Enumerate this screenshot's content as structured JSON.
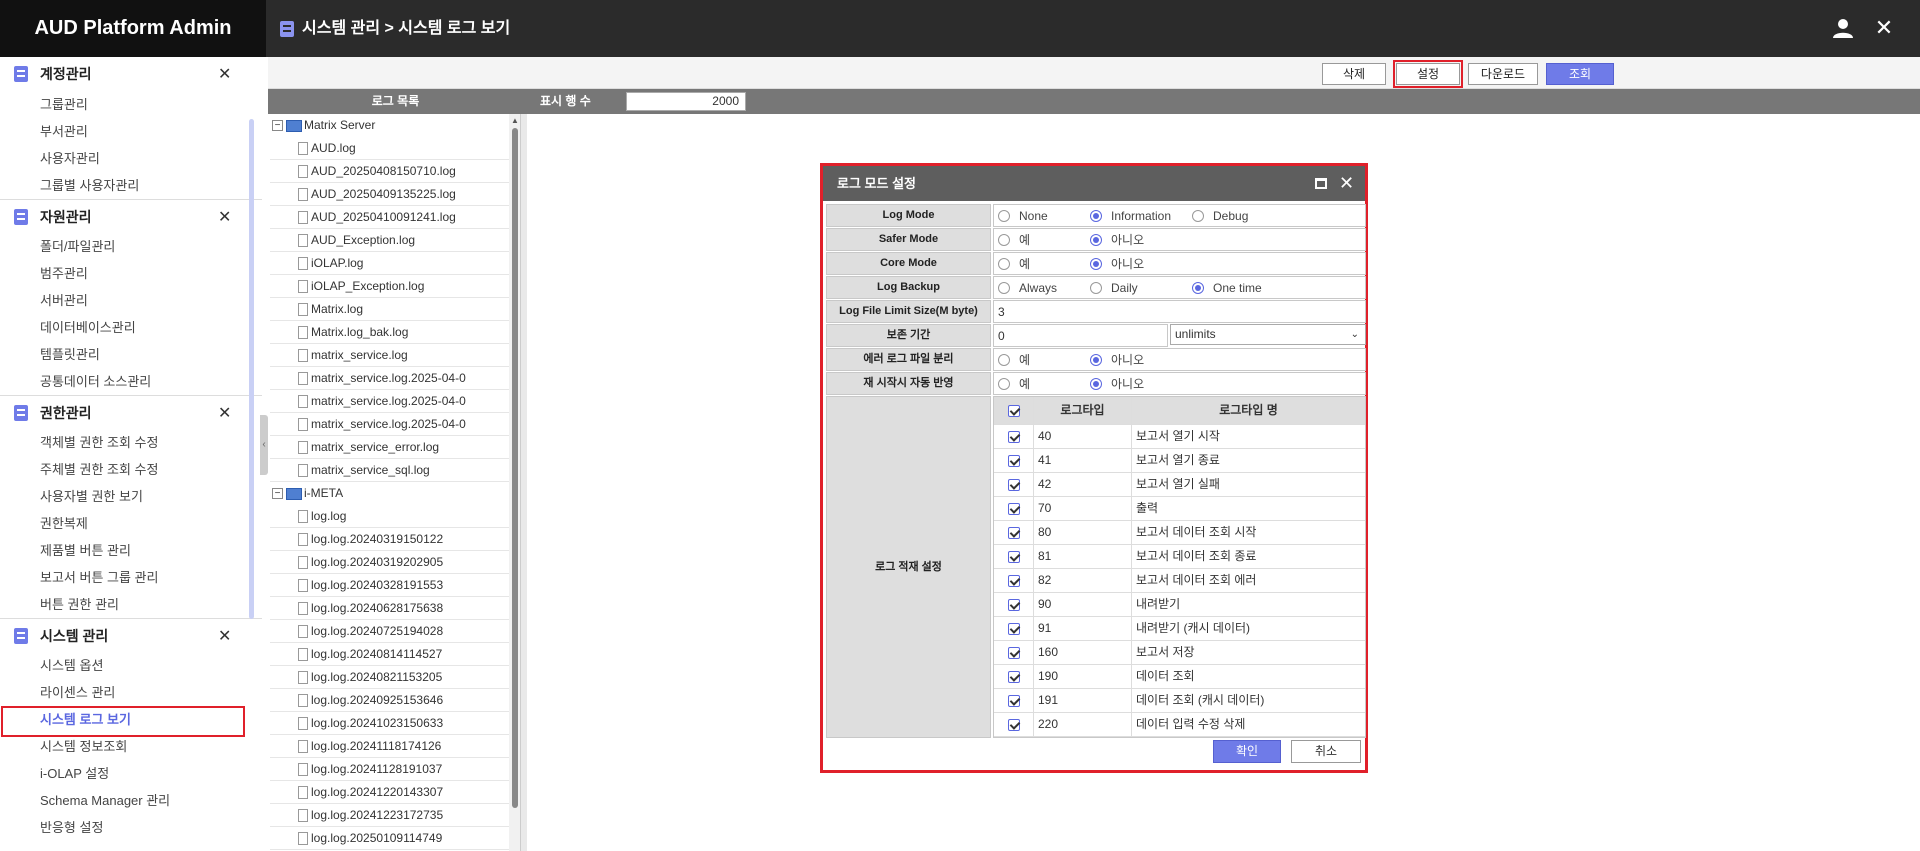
{
  "app": {
    "title": "AUD Platform Admin"
  },
  "header": {
    "breadcrumb": "시스템 관리 > 시스템 로그 보기"
  },
  "sidebar": {
    "sections": [
      {
        "title": "계정관리",
        "items": [
          "그룹관리",
          "부서관리",
          "사용자관리",
          "그룹별 사용자관리"
        ]
      },
      {
        "title": "자원관리",
        "items": [
          "폴더/파일관리",
          "범주관리",
          "서버관리",
          "데이터베이스관리",
          "템플릿관리",
          "공통데이터 소스관리"
        ]
      },
      {
        "title": "권한관리",
        "items": [
          "객체별 권한 조회 수정",
          "주체별 권한 조회 수정",
          "사용자별 권한 보기",
          "권한복제",
          "제품별 버튼 관리",
          "보고서 버튼 그룹 관리",
          "버튼 권한 관리"
        ]
      },
      {
        "title": "시스템 관리",
        "items": [
          "시스템 옵션",
          "라이센스 관리",
          "시스템 로그 보기",
          "시스템 정보조회",
          "i-OLAP 설정",
          "Schema Manager 관리",
          "반응형 설정"
        ]
      }
    ],
    "active_item": "시스템 로그 보기"
  },
  "toolbar": {
    "delete": "삭제",
    "settings": "설정",
    "download": "다운로드",
    "search": "조회"
  },
  "grid": {
    "log_list_title": "로그 목록",
    "rows_label": "표시 행 수",
    "rows_value": "2000"
  },
  "tree": {
    "servers": [
      {
        "name": "Matrix Server",
        "files": [
          "AUD.log",
          "AUD_20250408150710.log",
          "AUD_20250409135225.log",
          "AUD_20250410091241.log",
          "AUD_Exception.log",
          "iOLAP.log",
          "iOLAP_Exception.log",
          "Matrix.log",
          "Matrix.log_bak.log",
          "matrix_service.log",
          "matrix_service.log.2025-04-0",
          "matrix_service.log.2025-04-0",
          "matrix_service.log.2025-04-0",
          "matrix_service_error.log",
          "matrix_service_sql.log"
        ]
      },
      {
        "name": "i-META",
        "files": [
          "log.log",
          "log.log.20240319150122",
          "log.log.20240319202905",
          "log.log.20240328191553",
          "log.log.20240628175638",
          "log.log.20240725194028",
          "log.log.20240814114527",
          "log.log.20240821153205",
          "log.log.20240925153646",
          "log.log.20241023150633",
          "log.log.20241118174126",
          "log.log.20241128191037",
          "log.log.20241220143307",
          "log.log.20241223172735",
          "log.log.20250109114749"
        ]
      }
    ]
  },
  "dialog": {
    "title": "로그 모드 설정",
    "fields": {
      "log_mode": {
        "label": "Log Mode",
        "options": [
          "None",
          "Information",
          "Debug"
        ],
        "selected": "Information"
      },
      "safer_mode": {
        "label": "Safer Mode",
        "options": [
          "예",
          "아니오"
        ],
        "selected": "아니오"
      },
      "core_mode": {
        "label": "Core Mode",
        "options": [
          "예",
          "아니오"
        ],
        "selected": "아니오"
      },
      "log_backup": {
        "label": "Log Backup",
        "options": [
          "Always",
          "Daily",
          "One time"
        ],
        "selected": "One time"
      },
      "file_limit": {
        "label": "Log File Limit Size(M byte)",
        "value": "3"
      },
      "retention": {
        "label": "보존 기간",
        "value": "0",
        "unit": "unlimits"
      },
      "error_split": {
        "label": "에러 로그 파일 분리",
        "options": [
          "예",
          "아니오"
        ],
        "selected": "아니오"
      },
      "restart_apply": {
        "label": "재 시작시 자동 반영",
        "options": [
          "예",
          "아니오"
        ],
        "selected": "아니오"
      }
    },
    "logtype": {
      "label": "로그 적재 설정",
      "col_code": "로그타입",
      "col_name": "로그타입 명",
      "rows": [
        {
          "code": "40",
          "name": "보고서 열기 시작"
        },
        {
          "code": "41",
          "name": "보고서 열기 종료"
        },
        {
          "code": "42",
          "name": "보고서 열기 실패"
        },
        {
          "code": "70",
          "name": "출력"
        },
        {
          "code": "80",
          "name": "보고서 데이터 조회 시작"
        },
        {
          "code": "81",
          "name": "보고서 데이터 조회 종료"
        },
        {
          "code": "82",
          "name": "보고서 데이터 조회 에러"
        },
        {
          "code": "90",
          "name": "내려받기"
        },
        {
          "code": "91",
          "name": "내려받기 (캐시 데이터)"
        },
        {
          "code": "160",
          "name": "보고서 저장"
        },
        {
          "code": "190",
          "name": "데이터 조회"
        },
        {
          "code": "191",
          "name": "데이터 조회 (캐시 데이터)"
        },
        {
          "code": "220",
          "name": "데이터 입력 수정 삭제"
        }
      ]
    },
    "ok": "확인",
    "cancel": "취소"
  }
}
